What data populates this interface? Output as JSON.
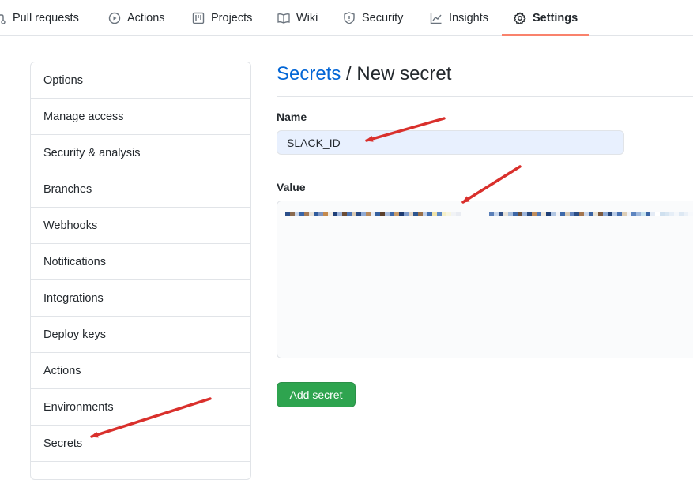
{
  "nav": {
    "tabs": [
      {
        "label": "Pull requests",
        "icon": "pull-request-icon"
      },
      {
        "label": "Actions",
        "icon": "play-icon"
      },
      {
        "label": "Projects",
        "icon": "project-icon"
      },
      {
        "label": "Wiki",
        "icon": "book-icon"
      },
      {
        "label": "Security",
        "icon": "shield-icon"
      },
      {
        "label": "Insights",
        "icon": "graph-icon"
      },
      {
        "label": "Settings",
        "icon": "gear-icon",
        "selected": true
      }
    ],
    "underline_color": "#f9826c"
  },
  "sidebar": {
    "items": [
      {
        "label": "Options"
      },
      {
        "label": "Manage access"
      },
      {
        "label": "Security & analysis"
      },
      {
        "label": "Branches"
      },
      {
        "label": "Webhooks"
      },
      {
        "label": "Notifications"
      },
      {
        "label": "Integrations"
      },
      {
        "label": "Deploy keys"
      },
      {
        "label": "Actions"
      },
      {
        "label": "Environments"
      },
      {
        "label": "Secrets"
      }
    ]
  },
  "page": {
    "breadcrumb_link": "Secrets",
    "separator": " / ",
    "title": "New secret"
  },
  "form": {
    "name_label": "Name",
    "name_value": "SLACK_ID",
    "value_label": "Value",
    "value_text": "[pixelated / redacted]",
    "submit_label": "Add secret"
  },
  "colors": {
    "link": "#0366d6",
    "primary_button": "#2ea44f",
    "arrow": "#d9302c",
    "name_field_bg": "#e8f0fe"
  }
}
